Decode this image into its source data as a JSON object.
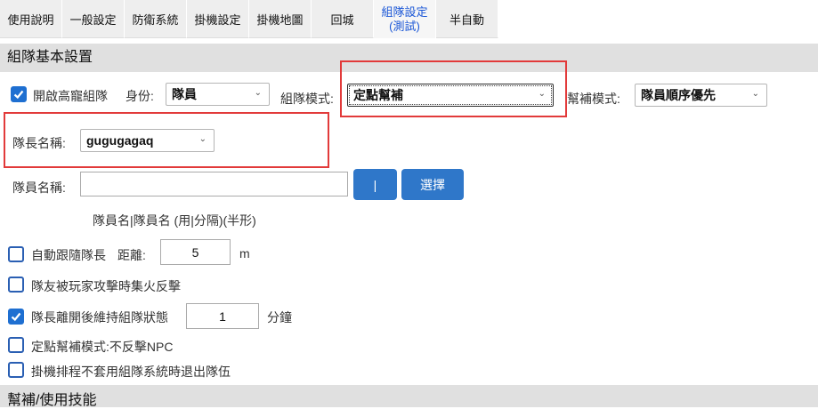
{
  "tabs": [
    {
      "label": "使用說明"
    },
    {
      "label": "一般設定"
    },
    {
      "label": "防衛系統"
    },
    {
      "label": "掛機設定"
    },
    {
      "label": "掛機地圖"
    },
    {
      "label": "回城"
    },
    {
      "label_line1": "組隊設定",
      "label_line2": "(測試)"
    },
    {
      "label": "半自動"
    }
  ],
  "active_tab": "組隊設定 (測試)",
  "section1": {
    "title": "組隊基本設置"
  },
  "row1": {
    "enable_label": "開啟高寵組隊",
    "enable_checked": true,
    "identity_label": "身份:",
    "identity_value": "隊員",
    "mode_label": "組隊模式:",
    "mode_value": "定點幫補",
    "help_label": "幫補模式:",
    "help_value": "隊員順序優先"
  },
  "leader": {
    "label": "隊長名稱:",
    "value": "gugugagaq"
  },
  "members": {
    "label": "隊員名稱:",
    "value": "",
    "sep_button": "|",
    "select_button": "選擇",
    "hint": "隊員名|隊員名 (用|分隔)(半形)"
  },
  "options": {
    "follow": {
      "label": "自動跟隨隊長",
      "checked": false,
      "distance_label": "距離:",
      "distance_value": "5",
      "distance_unit": "m"
    },
    "focus_fire": {
      "label": "隊友被玩家攻擊時集火反擊",
      "checked": false
    },
    "keep_party": {
      "label": "隊長離開後維持組隊狀態",
      "checked": true,
      "minutes_value": "1",
      "minutes_unit": "分鐘"
    },
    "no_npc": {
      "label": "定點幫補模式:不反擊NPC",
      "checked": false
    },
    "exit_party": {
      "label": "掛機排程不套用組隊系統時退出隊伍",
      "checked": false
    }
  },
  "section2": {
    "title": "幫補/使用技能"
  },
  "colors": {
    "accent": "#1e6fd1",
    "highlight": "#e23a3a",
    "section_bg": "#e0e0e0",
    "active_tab_text": "#1a56d6"
  }
}
